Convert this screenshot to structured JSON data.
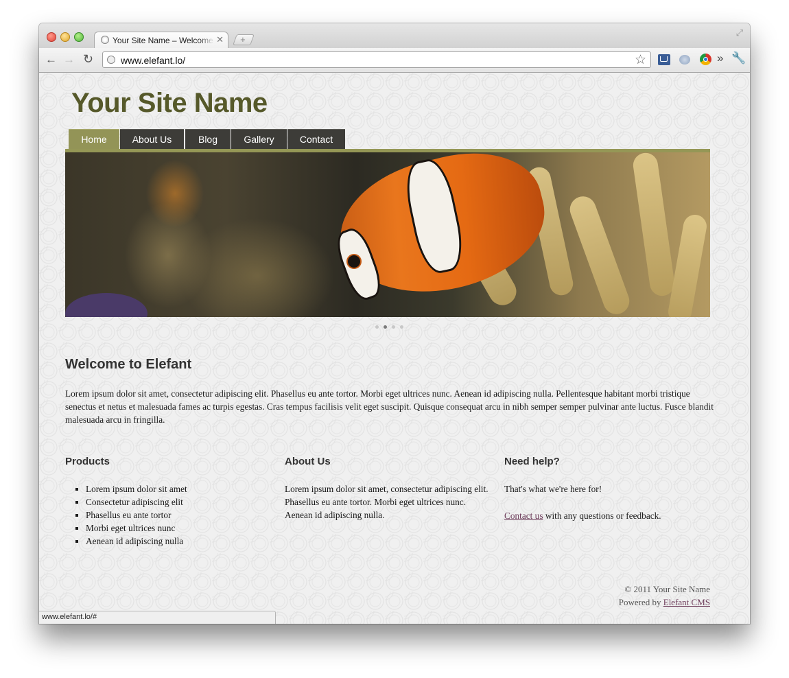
{
  "browser": {
    "tab_title": "Your Site Name – Welcome to Elefant",
    "tab_close": "✕",
    "new_tab": "+",
    "url": "www.elefant.lo/",
    "status_url": "www.elefant.lo/#",
    "icons": {
      "back": "←",
      "forward": "→",
      "reload": "↻",
      "star": "☆",
      "chevrons": "»",
      "wrench": "🔧",
      "resize": "⤢"
    }
  },
  "site": {
    "name": "Your Site Name",
    "nav": [
      "Home",
      "About Us",
      "Blog",
      "Gallery",
      "Contact"
    ],
    "active_nav": "Home",
    "slider_dots": 4,
    "slider_active_index": 1,
    "welcome_heading": "Welcome to Elefant",
    "welcome_text": "Lorem ipsum dolor sit amet, consectetur adipiscing elit. Phasellus eu ante tortor. Morbi eget ultrices nunc. Aenean id adipiscing nulla. Pellentesque habitant morbi tristique senectus et netus et malesuada fames ac turpis egestas. Cras tempus facilisis velit eget suscipit. Quisque consequat arcu in nibh semper semper pulvinar ante luctus. Fusce blandit malesuada arcu in fringilla.",
    "products": {
      "heading": "Products",
      "items": [
        "Lorem ipsum dolor sit amet",
        "Consectetur adipiscing elit",
        "Phasellus eu ante tortor",
        "Morbi eget ultrices nunc",
        "Aenean id adipiscing nulla"
      ]
    },
    "about": {
      "heading": "About Us",
      "text": "Lorem ipsum dolor sit amet, consectetur adipiscing elit. Phasellus eu ante tortor. Morbi eget ultrices nunc. Aenean id adipiscing nulla."
    },
    "help": {
      "heading": "Need help?",
      "line1": "That's what we're here for!",
      "contact_link": "Contact us",
      "line2_rest": " with any questions or feedback."
    },
    "footer": {
      "copyright": "© 2011 Your Site Name",
      "powered_prefix": "Powered by ",
      "powered_link": "Elefant CMS"
    }
  },
  "colors": {
    "site_name": "#56592a",
    "nav_bg": "#3d3c38",
    "nav_active": "#939457",
    "link": "#6b3a58"
  }
}
